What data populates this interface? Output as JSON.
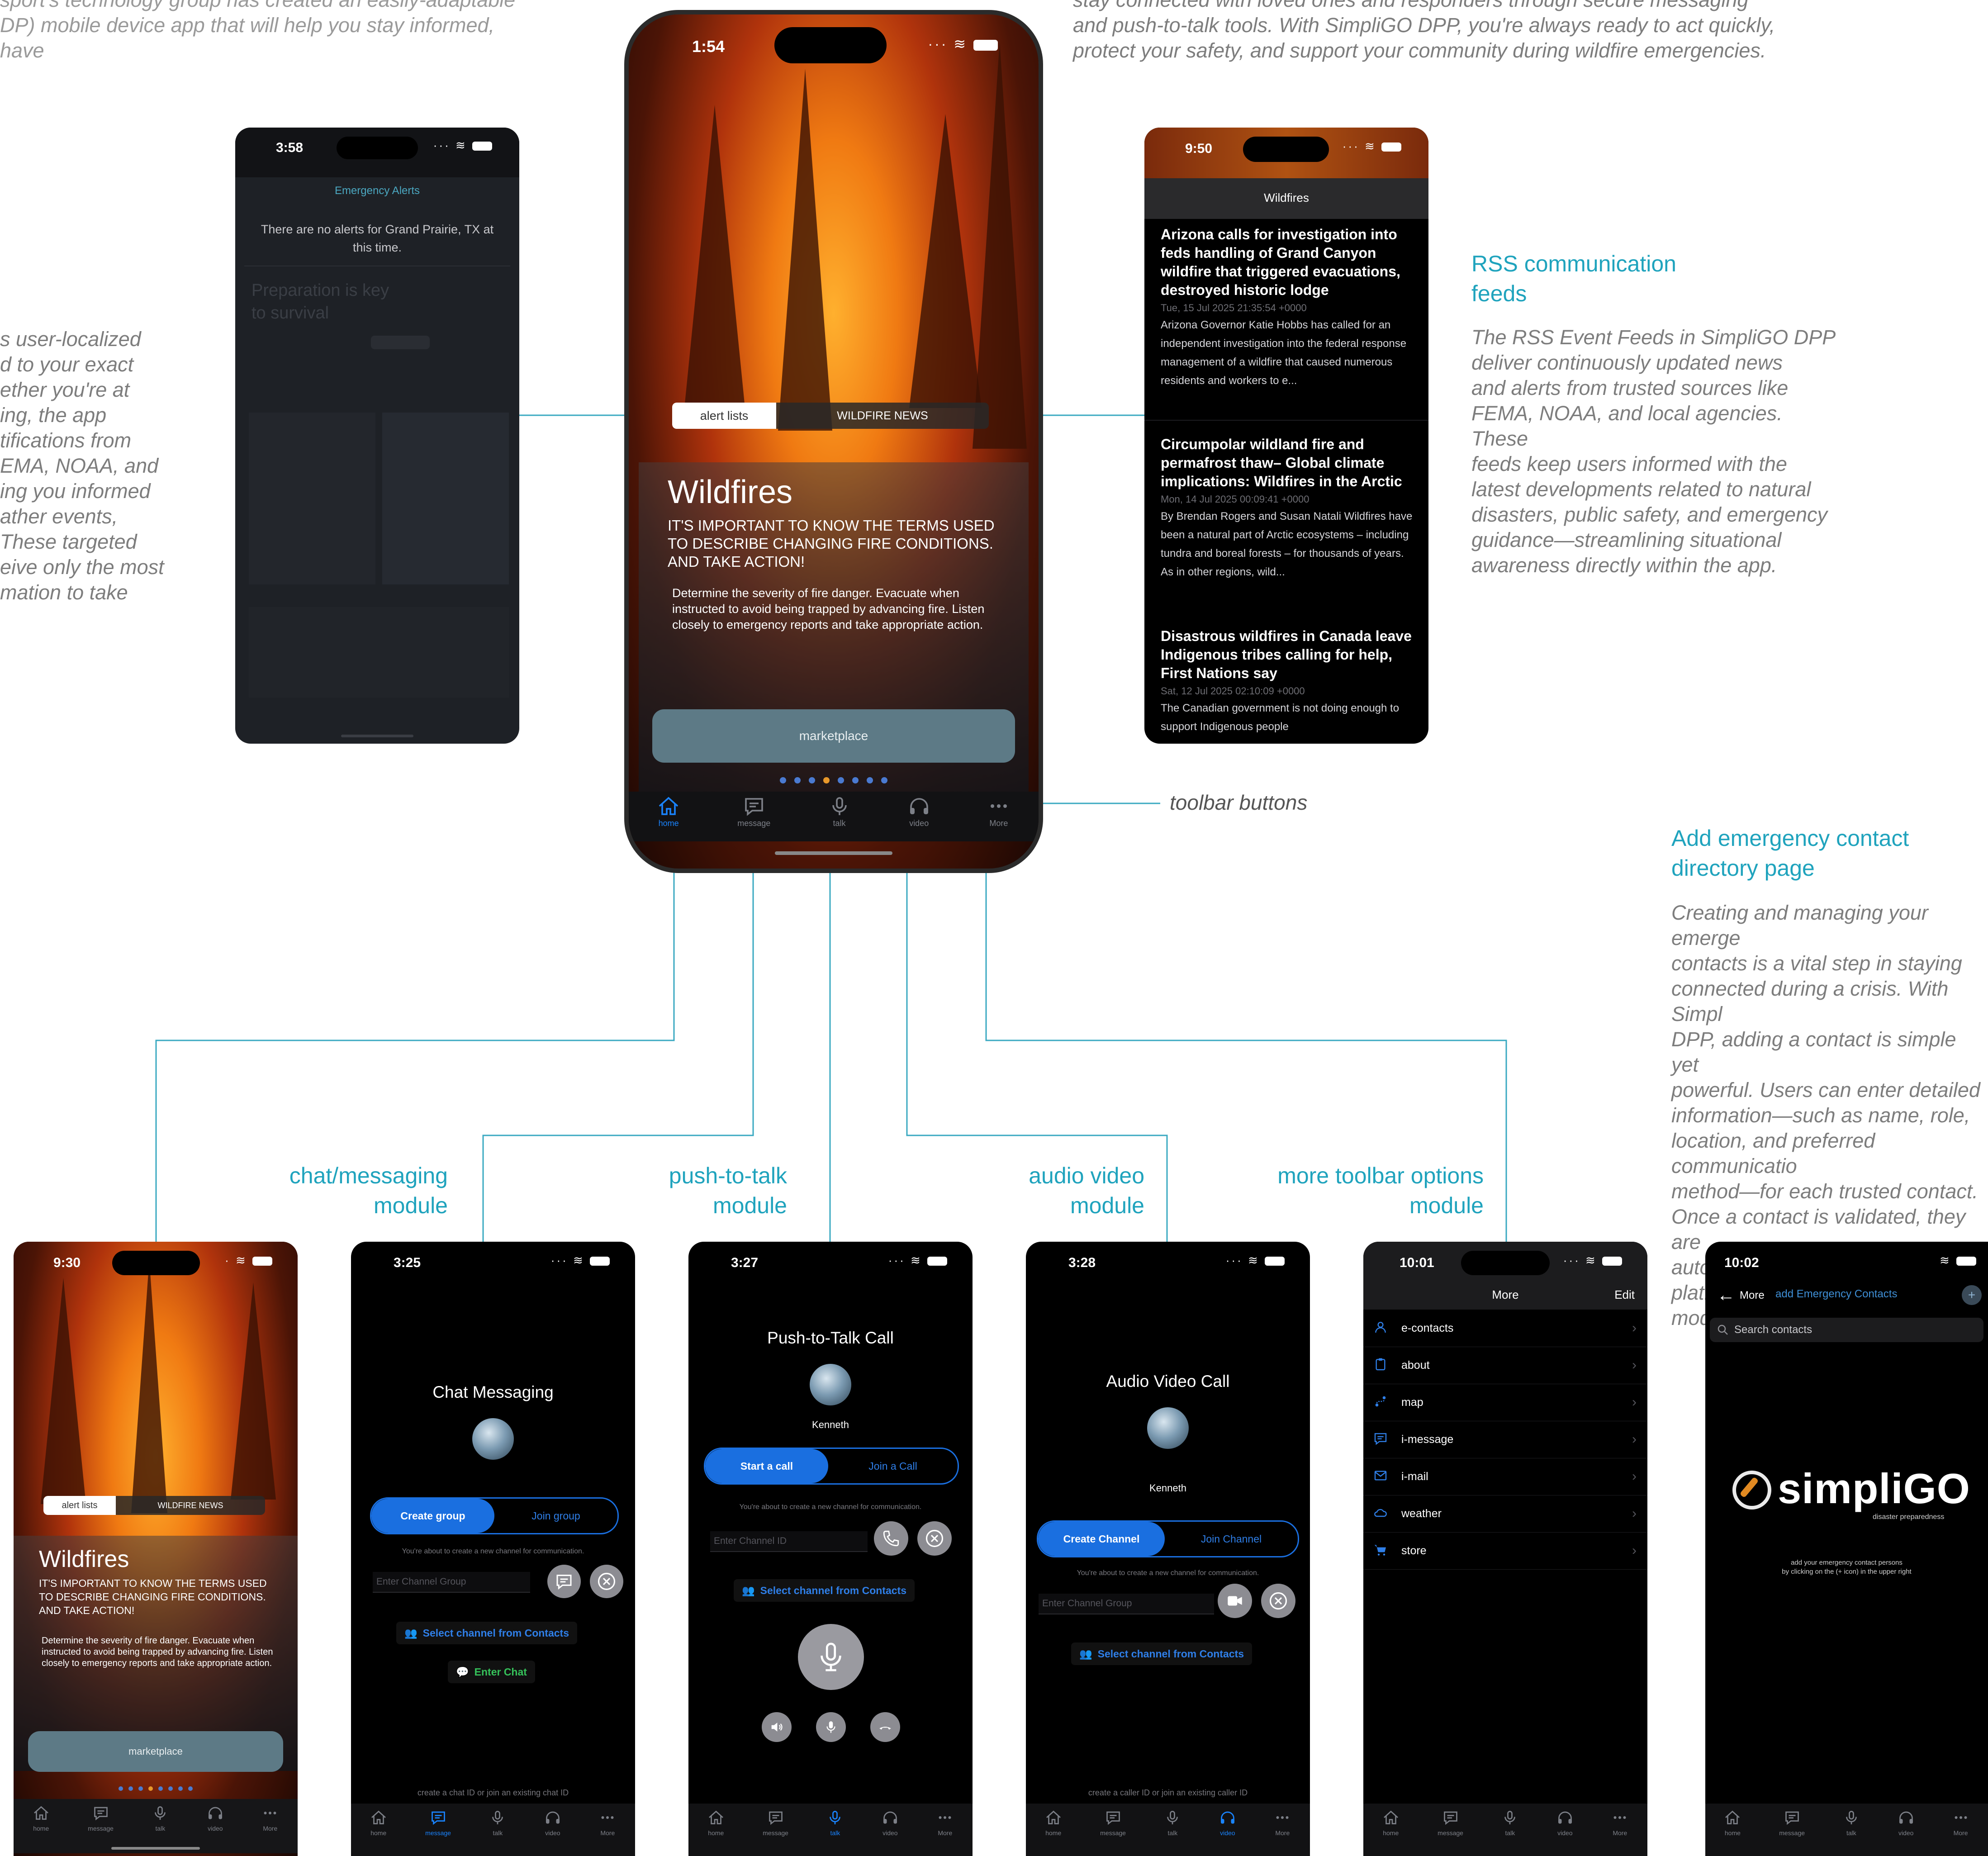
{
  "intro_left_top": "sport's technology group has created an easily-adaptable\nDP) mobile device app that will help you stay informed, have",
  "intro_right_top": "stay connected with loved ones and responders through secure messaging\nand push-to-talk tools. With SimpliGO DPP, you're always ready to act quickly,\nprotect your safety, and support your community during wildfire emergencies.",
  "left_prose": "s user-localized\nd to your exact\nether you're at\ning, the app\ntifications from\nEMA, NOAA, and\ning you informed\nather events,\nThese targeted\neive only the most\nmation to take",
  "rss_heading": "RSS communication\nfeeds",
  "rss_prose": "The RSS Event Feeds in SimpliGO DPP\ndeliver continuously updated news\nand alerts from trusted sources like\nFEMA, NOAA, and local agencies. These\nfeeds keep users informed with the\nlatest developments related to natural\ndisasters, public safety, and emergency\nguidance—streamlining situational\nawareness directly within the app.",
  "toolbar_label": "toolbar buttons",
  "contacts_heading": "Add emergency contact\ndirectory page",
  "contacts_prose": "Creating and managing your emerge\ncontacts is a vital step in staying\nconnected during a crisis. With Simpl\nDPP, adding a contact is simple yet\npowerful. Users can enter detailed\ninformation—such as name, role,\nlocation, and preferred communicatio\nmethod—for each trusted contact.\nOnce a contact is validated, they are\nautomatically integrated into the\nplatform's secure communication\nmodules.",
  "module_headings": {
    "chat": "chat/messaging\nmodule",
    "ptt": "push-to-talk\nmodule",
    "av": "audio video\nmodule",
    "more": "more toolbar options\nmodule"
  },
  "main_phone": {
    "time": "1:54",
    "tab_active": "alert lists",
    "tab_inactive": "WILDFIRE NEWS",
    "title": "Wildfires",
    "subtitle": "IT'S IMPORTANT TO KNOW THE TERMS USED TO DESCRIBE CHANGING FIRE CONDITIONS. AND TAKE ACTION!",
    "body": "Determine the severity of fire danger. Evacuate when instructed to avoid being trapped by advancing fire. Listen closely to emergency reports and take appropriate action.",
    "button": "marketplace",
    "page_count": 8,
    "page_active": 3
  },
  "tabbar": {
    "home": "home",
    "message": "message",
    "talk": "talk",
    "video": "video",
    "more": "More"
  },
  "alerts_phone": {
    "time": "3:58",
    "title": "Emergency Alerts",
    "message": "There are no alerts for Grand Prairie, TX at this time.",
    "ghost_text": "Preparation is key to survival"
  },
  "rss_phone": {
    "time": "9:50",
    "title": "Wildfires",
    "items": [
      {
        "title": "Arizona calls for investigation into feds handling of Grand Canyon wildfire that triggered evacuations, destroyed historic lodge",
        "date": "Tue, 15 Jul 2025 21:35:54 +0000",
        "body": "Arizona Governor Katie Hobbs has called for an independent investigation into the federal response management of a wildfire that caused numerous residents and workers to e..."
      },
      {
        "title": "Circumpolar wildland fire and permafrost thaw– Global climate implications: Wildfires in the Arctic",
        "date": "Mon, 14 Jul 2025 00:09:41 +0000",
        "body": "By Brendan Rogers and Susan Natali Wildfires have been a natural part of Arctic ecosystems – including tundra and boreal forests – for thousands of years. As in other regions, wild..."
      },
      {
        "title": "Disastrous wildfires in Canada leave Indigenous tribes calling for help, First Nations say",
        "date": "Sat, 12 Jul 2025 02:10:09 +0000",
        "body": "The Canadian government is not doing enough to support Indigenous people"
      }
    ]
  },
  "home_phone": {
    "time": "9:30",
    "tab_active": "alert lists",
    "tab_inactive": "WILDFIRE NEWS",
    "title": "Wildfires",
    "subtitle": "IT'S IMPORTANT TO KNOW THE TERMS USED TO DESCRIBE CHANGING FIRE CONDITIONS. AND TAKE ACTION!",
    "body": "Determine the severity of fire danger. Evacuate when instructed to avoid being trapped by advancing fire. Listen closely to emergency reports and take appropriate action.",
    "button": "marketplace"
  },
  "chat_phone": {
    "time": "3:25",
    "title": "Chat Messaging",
    "seg_a": "Create group",
    "seg_b": "Join group",
    "hint": "You're about to create a new channel for communication.",
    "placeholder": "Enter Channel Group",
    "select_link": "Select channel from Contacts",
    "enter_link": "Enter Chat",
    "bottom_hint": "create a chat ID or join an existing chat ID"
  },
  "ptt_phone": {
    "time": "3:27",
    "title": "Push-to-Talk Call",
    "name": "Kenneth",
    "seg_a": "Start a call",
    "seg_b": "Join a Call",
    "hint": "You're about to create a new channel for communication.",
    "placeholder": "Enter Channel ID",
    "select_link": "Select channel from Contacts"
  },
  "av_phone": {
    "time": "3:28",
    "title": "Audio Video Call",
    "name": "Kenneth",
    "seg_a": "Create Channel",
    "seg_b": "Join Channel",
    "hint": "You're about to create a new channel for communication.",
    "placeholder": "Enter Channel Group",
    "select_link": "Select channel from Contacts",
    "bottom_hint": "create a caller ID or join an existing caller ID"
  },
  "more_phone": {
    "time": "10:01",
    "title": "More",
    "edit": "Edit",
    "rows": [
      "e-contacts",
      "about",
      "map",
      "i-message",
      "i-mail",
      "weather",
      "store"
    ]
  },
  "contacts_phone": {
    "time": "10:02",
    "back": "More",
    "title": "add Emergency Contacts",
    "search_placeholder": "Search contacts",
    "logo_text": "simpliGO",
    "logo_tagline": "disaster preparedness",
    "hint_line1": "add your emergency contact persons",
    "hint_line2": "by clicking on the (+ icon) in the upper right"
  },
  "colors": {
    "accent_teal": "#1fa3bd",
    "ios_blue": "#1a6fe0",
    "page_dot_active": "#e8982a"
  }
}
